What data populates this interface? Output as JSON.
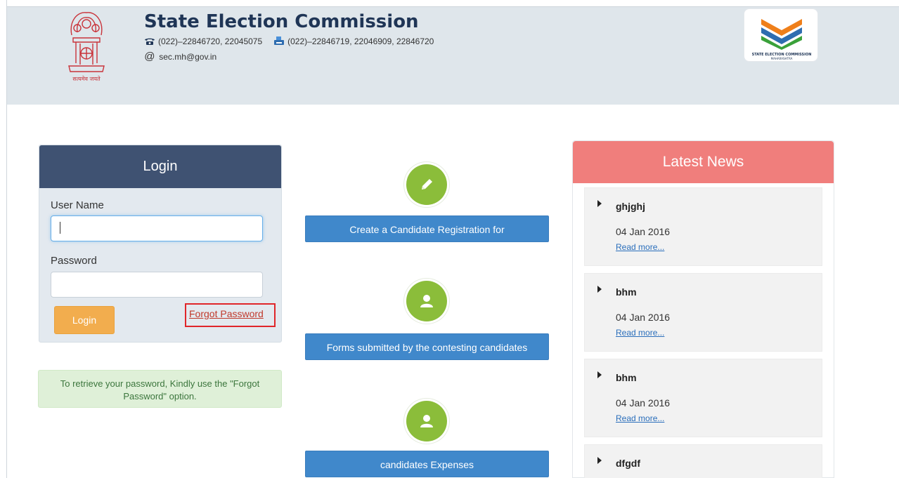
{
  "header": {
    "title": "State Election Commission",
    "phone": "(022)–22846720, 22045075",
    "fax": "(022)–22846719, 22046909, 22846720",
    "email": "sec.mh@gov.in",
    "emblem_caption": "सत्यमेव जयते",
    "logo_line1": "STATE ELECTION COMMISSION",
    "logo_line2": "MAHARASHTRA",
    "icons": {
      "phone": "telephone-icon",
      "fax": "fax-icon",
      "email": "at-sign-icon"
    }
  },
  "login": {
    "heading": "Login",
    "username_label": "User Name",
    "username_value": "",
    "password_label": "Password",
    "password_value": "",
    "button_label": "Login",
    "forgot_label": "Forgot Password"
  },
  "info_message": "To retrieve your password, Kindly use the \"Forgot Password\" option.",
  "actions": [
    {
      "label": "Create a Candidate Registration for",
      "icon": "pencil-icon"
    },
    {
      "label": "Forms submitted by the contesting candidates",
      "icon": "user-icon"
    },
    {
      "label": "candidates Expenses",
      "icon": "user-icon"
    }
  ],
  "news": {
    "heading": "Latest News",
    "items": [
      {
        "title": "ghjghj",
        "date": "04 Jan 2016",
        "link": "Read more..."
      },
      {
        "title": "bhm",
        "date": "04 Jan 2016",
        "link": "Read more..."
      },
      {
        "title": "bhm",
        "date": "04 Jan 2016",
        "link": "Read more..."
      },
      {
        "title": "dfgdf",
        "date": "",
        "link": ""
      }
    ]
  },
  "colors": {
    "header_bg": "#dfe6eb",
    "login_head": "#3f5272",
    "login_button": "#f2ad4e",
    "action_button": "#4088cb",
    "action_icon": "#8bbd3a",
    "news_head": "#f07e7c",
    "highlight_border": "#e0262a"
  }
}
